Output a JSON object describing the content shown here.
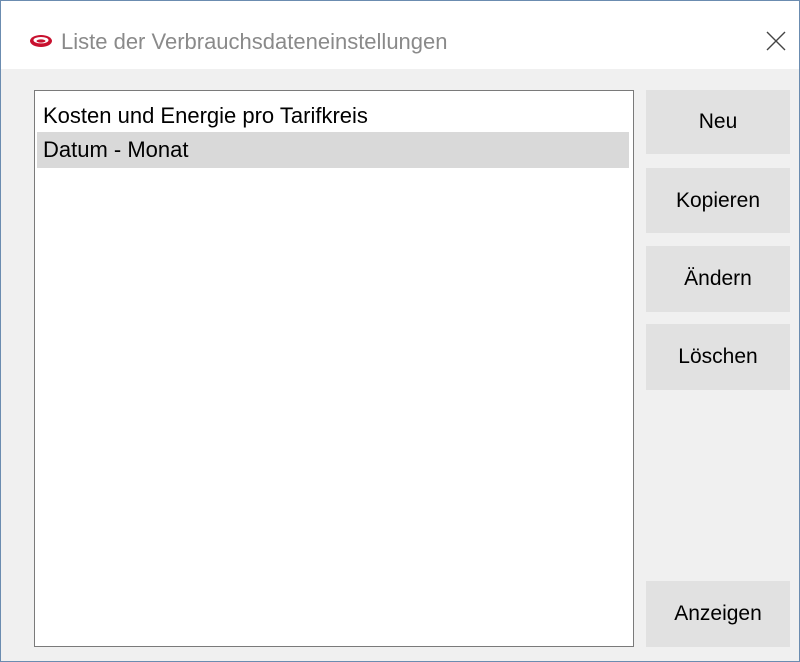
{
  "window": {
    "title": "Liste der Verbrauchsdateneinstellungen",
    "icon": "app-logo-icon",
    "close_icon": "close-icon",
    "accent_color": "#c8102e"
  },
  "list": {
    "items": [
      {
        "label": "Kosten und Energie pro Tarifkreis",
        "selected": false
      },
      {
        "label": "Datum - Monat",
        "selected": true
      }
    ]
  },
  "buttons": {
    "new_label": "Neu",
    "copy_label": "Kopieren",
    "edit_label": "Ändern",
    "delete_label": "Löschen",
    "show_label": "Anzeigen"
  }
}
